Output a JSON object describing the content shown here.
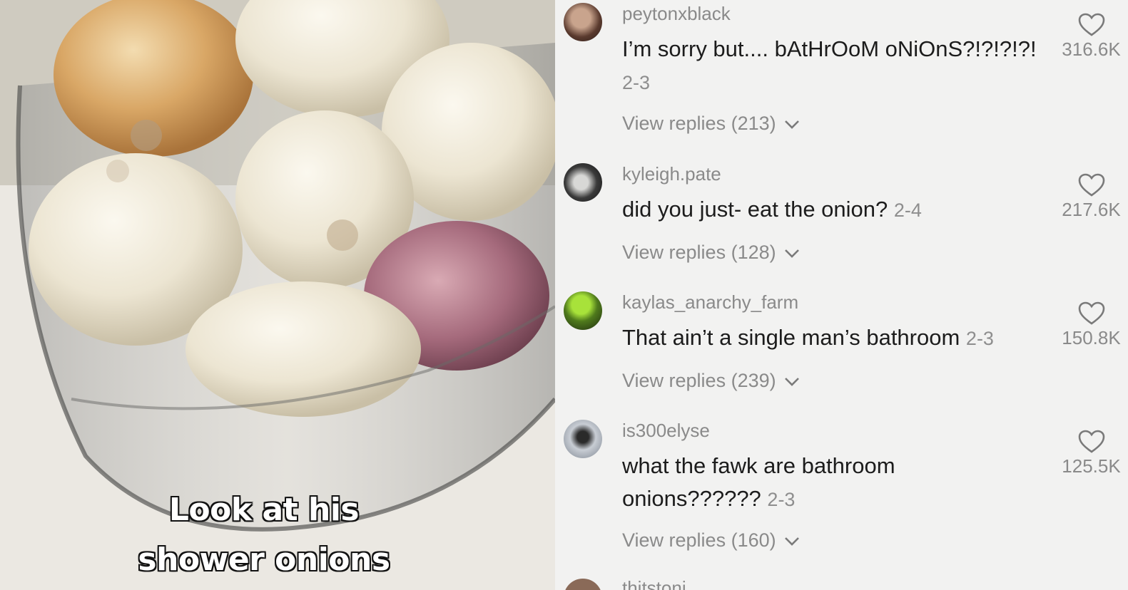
{
  "video": {
    "caption_line1": "Look at his",
    "caption_line2": "shower onions"
  },
  "colors": {
    "panel_bg": "#f2f2f1",
    "username": "#8a8a8a",
    "comment_text": "#1c1c1c",
    "meta": "#8e8e8e"
  },
  "comments": [
    {
      "username": "peytonxblack",
      "text": "I’m sorry but.... bAtHrOoM oNiOnS?!?!?!?!",
      "date": "2-3",
      "replies": "View replies (213)",
      "likes": "316.6K",
      "icon": "heart-outline-icon"
    },
    {
      "username": "kyleigh.pate",
      "text": "did you just- eat the onion?",
      "date": "2-4",
      "replies": "View replies (128)",
      "likes": "217.6K",
      "icon": "heart-outline-icon"
    },
    {
      "username": "kaylas_anarchy_farm",
      "text": "That ain’t a single man’s bathroom",
      "date": "2-3",
      "replies": "View replies (239)",
      "likes": "150.8K",
      "icon": "heart-outline-icon"
    },
    {
      "username": "is300elyse",
      "text": "what the fawk are bathroom onions??????",
      "date": "2-3",
      "replies": "View replies (160)",
      "likes": "125.5K",
      "icon": "heart-outline-icon"
    }
  ],
  "partial_username": "thjtstoni"
}
